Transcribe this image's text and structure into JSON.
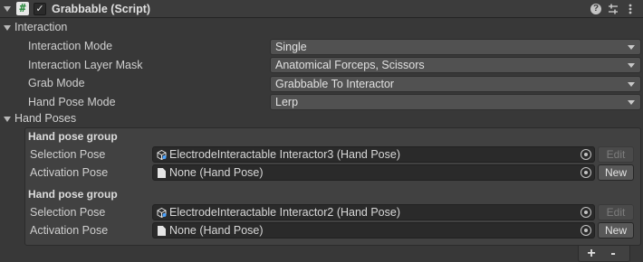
{
  "component": {
    "title": "Grabbable (Script)",
    "icon": "csharp-script-icon",
    "enabled_mark": "✓"
  },
  "header_icons": [
    "help-icon",
    "presets-icon",
    "context-menu-icon"
  ],
  "interaction": {
    "label": "Interaction",
    "fields": [
      {
        "label": "Interaction Mode",
        "value": "Single"
      },
      {
        "label": "Interaction Layer Mask",
        "value": "Anatomical Forceps, Scissors"
      },
      {
        "label": "Grab Mode",
        "value": "Grabbable To Interactor"
      },
      {
        "label": "Hand Pose Mode",
        "value": "Lerp"
      }
    ]
  },
  "hand_poses": {
    "label": "Hand Poses",
    "groups": [
      {
        "title": "Hand pose group",
        "selection_label": "Selection Pose",
        "selection_value": "ElectrodeInteractable Interactor3 (Hand Pose)",
        "selection_button": "Edit",
        "activation_label": "Activation Pose",
        "activation_value": "None (Hand Pose)",
        "activation_button": "New"
      },
      {
        "title": "Hand pose group",
        "selection_label": "Selection Pose",
        "selection_value": "ElectrodeInteractable Interactor2 (Hand Pose)",
        "selection_button": "Edit",
        "activation_label": "Activation Pose",
        "activation_value": "None (Hand Pose)",
        "activation_button": "New"
      }
    ],
    "add_label": "+",
    "remove_label": "-"
  },
  "colors": {
    "background": "#383838",
    "field": "#515151",
    "object_field": "#2a2a2a",
    "script_icon_green": "#2b8a3e"
  }
}
